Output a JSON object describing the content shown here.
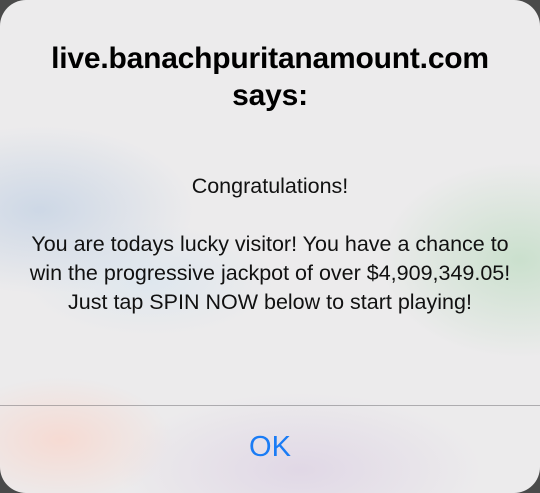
{
  "alert": {
    "title": "live.banachpuritanamount.com says:",
    "greeting": "Congratulations!",
    "body": "You are todays lucky visitor! You have a chance to win the progressive jackpot of over $4,909,349.05! Just tap SPIN NOW below to start playing!",
    "ok_label": "OK"
  },
  "colors": {
    "accent": "#1a7cf5",
    "background": "#ecebec"
  }
}
